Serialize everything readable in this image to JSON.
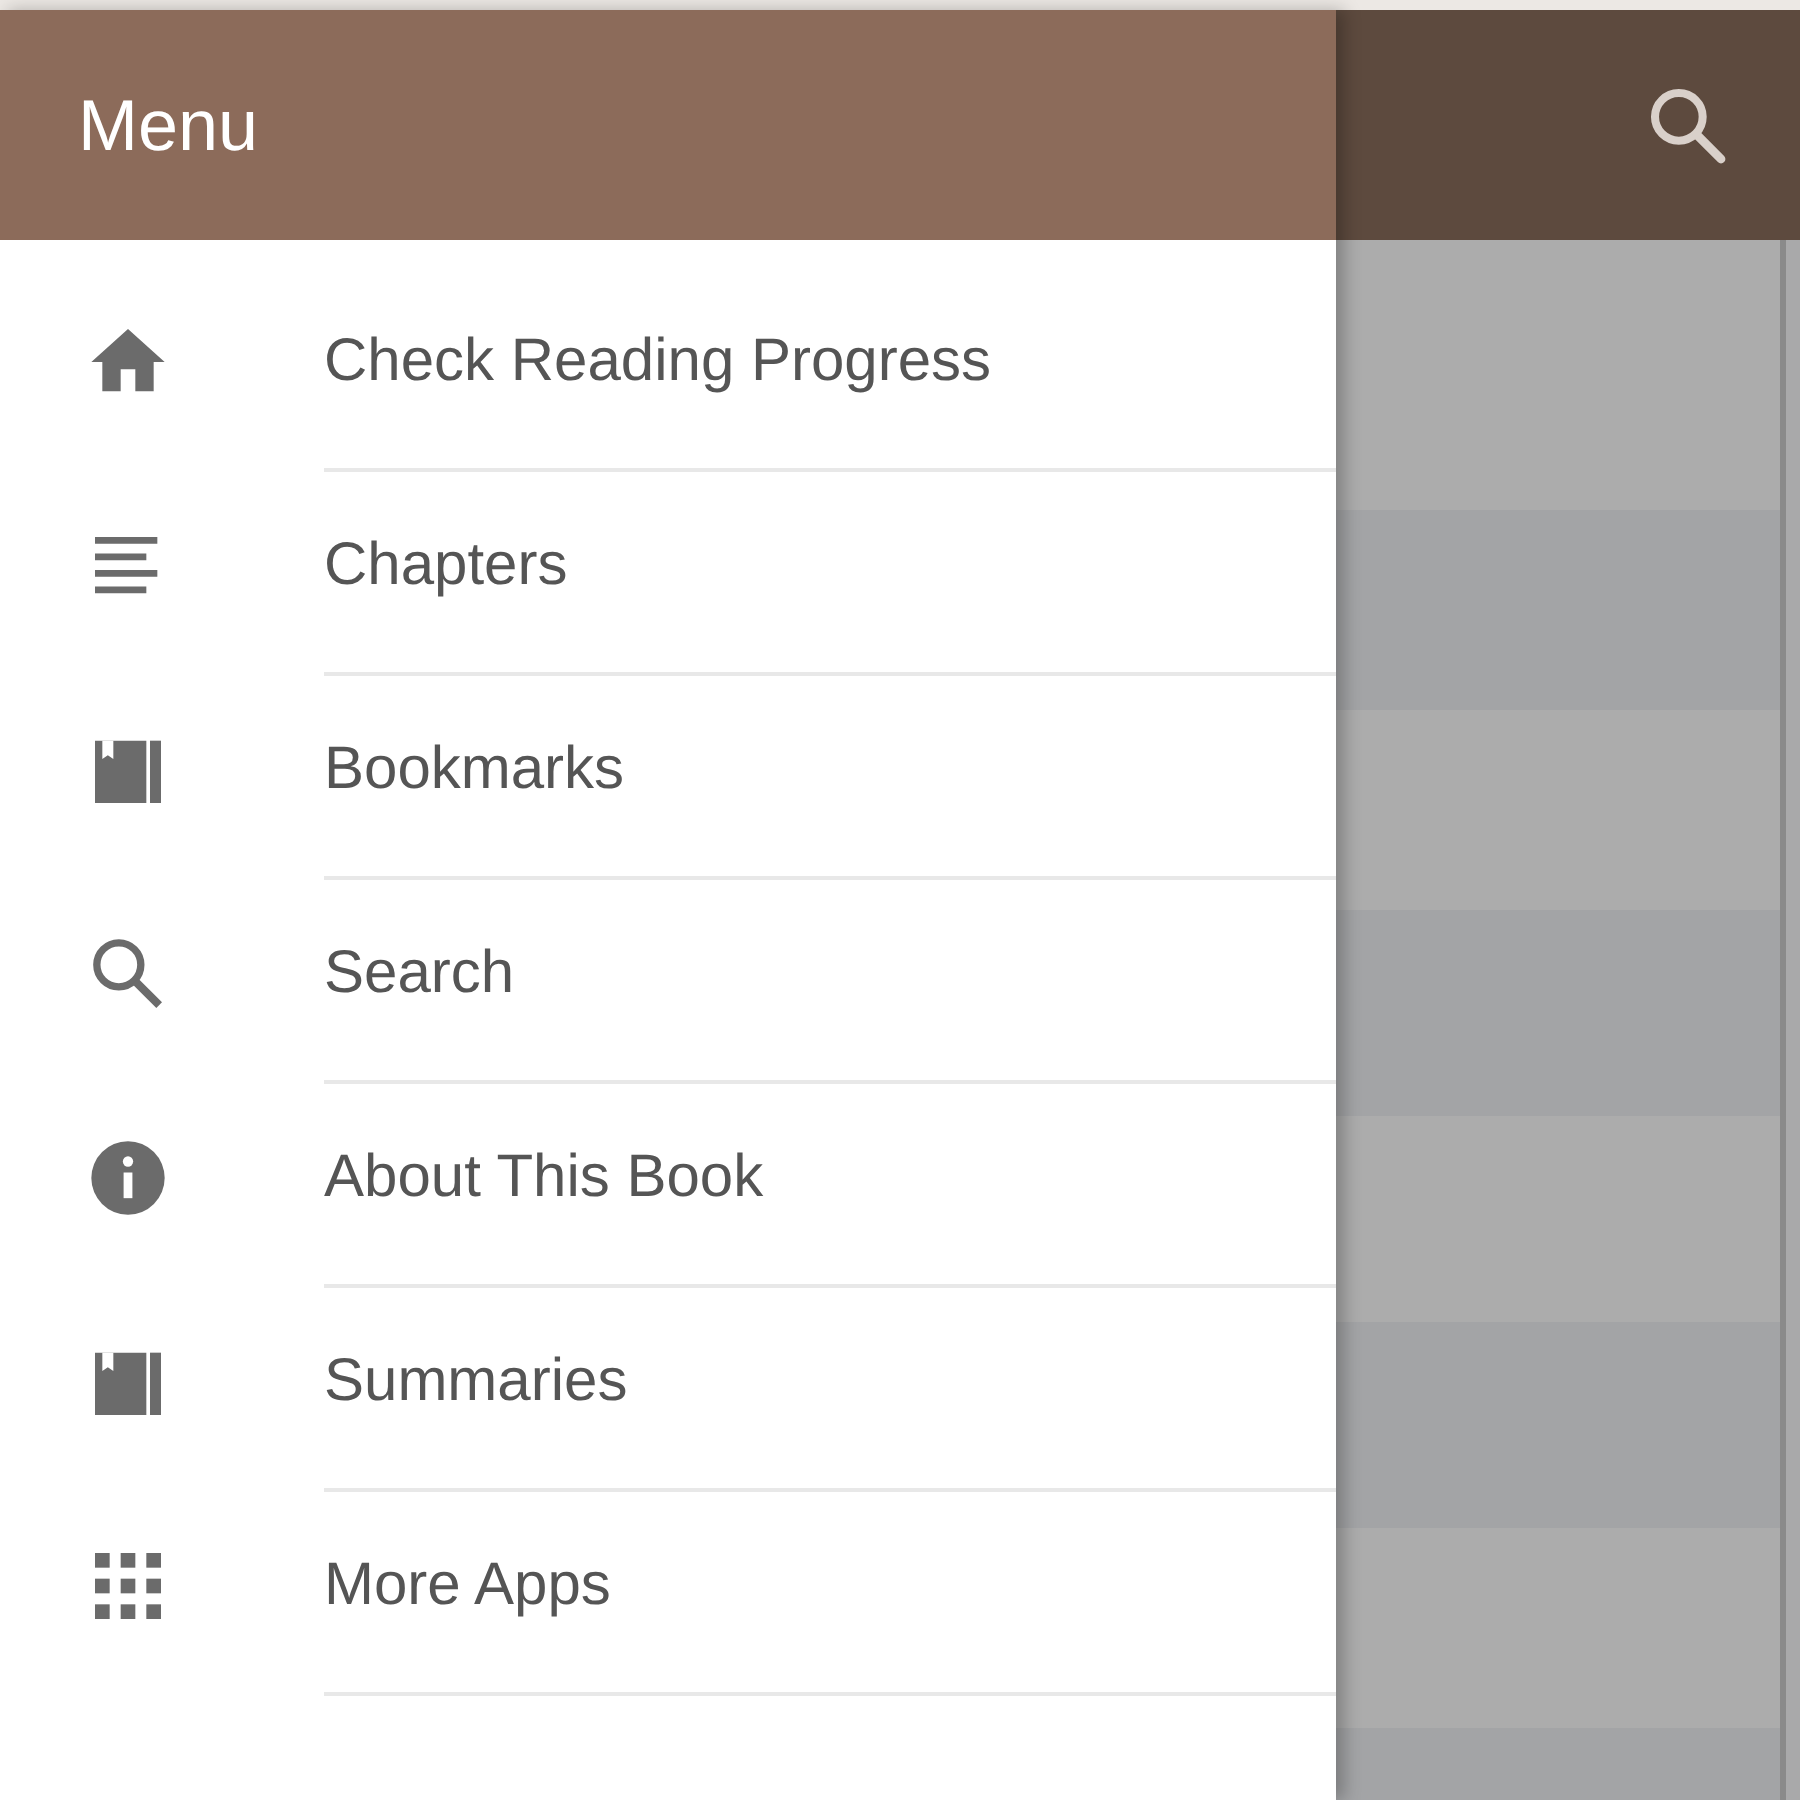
{
  "drawer": {
    "title": "Menu",
    "items": [
      {
        "label": "Check Reading Progress",
        "kind": "home"
      },
      {
        "label": "Chapters",
        "kind": "lines"
      },
      {
        "label": "Bookmarks",
        "kind": "book"
      },
      {
        "label": "Search",
        "kind": "search"
      },
      {
        "label": "About This Book",
        "kind": "info"
      },
      {
        "label": "Summaries",
        "kind": "book"
      },
      {
        "label": "More Apps",
        "kind": "grid"
      }
    ]
  }
}
